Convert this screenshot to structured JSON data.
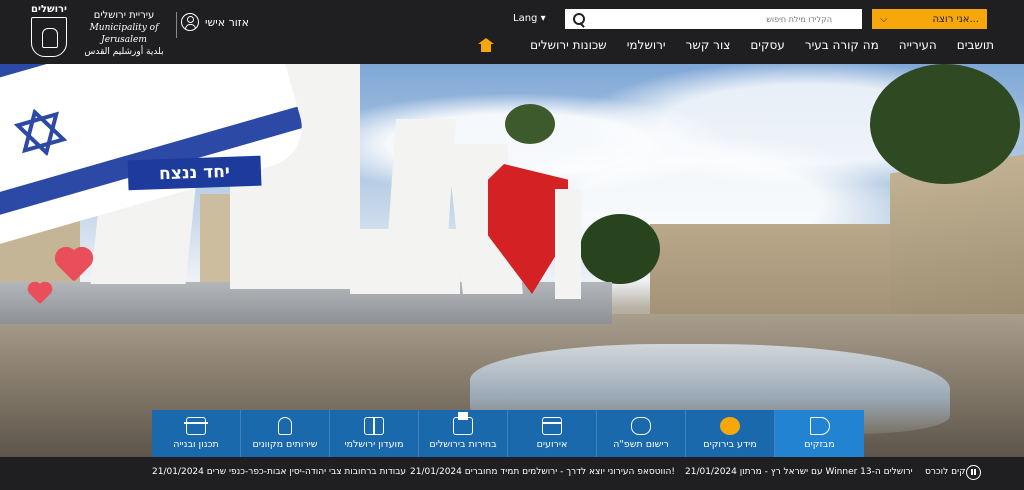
{
  "header": {
    "logo_title": "ירושלים",
    "municipality_he": "עיריית ירושלים",
    "municipality_en": "Municipality of Jerusalem",
    "municipality_ar": "بلدية أورشليم القدس",
    "personal_area": "אזור אישי",
    "lang": "Lang ▾",
    "search_placeholder": "הקלידו מילת חיפוש",
    "want_label": "אני רוצה..."
  },
  "nav": {
    "items": [
      "תושבים",
      "העירייה",
      "מה קורה בעיר",
      "עסקים",
      "צור קשר",
      "ירושלמי",
      "שכונות ירושלים"
    ]
  },
  "hero": {
    "slogan": "יחד ננצח"
  },
  "tiles": [
    {
      "label": "תכנון ובנייה",
      "icon": "crane-icon"
    },
    {
      "label": "שירותים מקוונים",
      "icon": "hand-click-icon"
    },
    {
      "label": "מועדון ירושלמי",
      "icon": "gift-icon"
    },
    {
      "label": "בחירות בירושלים",
      "icon": "ballot-icon"
    },
    {
      "label": "אירועים",
      "icon": "calendar-icon"
    },
    {
      "label": "רישום תשפ\"ה",
      "icon": "school-bag-icon"
    },
    {
      "label": "מידע בירוקים",
      "icon": "info-icon"
    },
    {
      "label": "מבזקים",
      "icon": "megaphone-icon"
    }
  ],
  "ticker": {
    "pause_label": "קים לוכרס",
    "items": [
      "21/01/2024 עבודות ברחובות צבי יהודה-יסין אבות-כפר-כנפי שרים",
      "21/01/2024 הווטסאפ העירוני יוצא לדרך - ירושלמים תמיד מחוברים!",
      "21/01/2024 עם ישראל רץ - מרתון Winner ירושלים ה-13"
    ]
  },
  "colors": {
    "header_bg": "#1f1f21",
    "accent_orange": "#f6a70b",
    "tile_blue": "#1a69ad",
    "tile_active": "#2283d3",
    "flag_blue": "#2c4aa5"
  }
}
